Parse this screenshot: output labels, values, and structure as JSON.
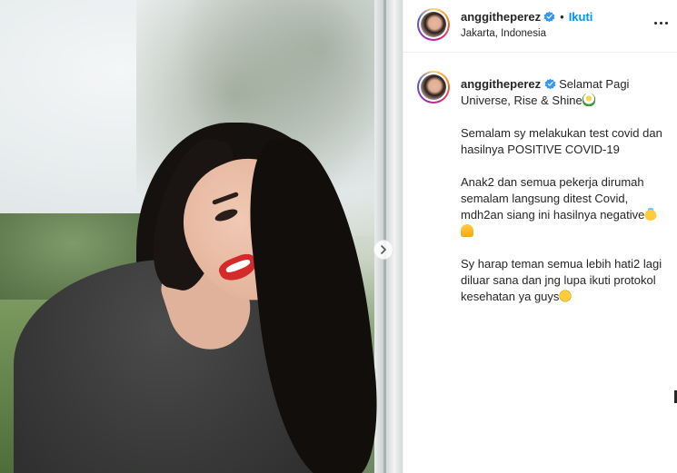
{
  "post": {
    "username": "anggitheperez",
    "follow_label": "Ikuti",
    "separator": "•",
    "location": "Jakarta, Indonesia",
    "caption": {
      "username": "anggitheperez",
      "line1": "Selamat Pagi Universe, Rise & Shine",
      "line1_emoji": "flower-emoji",
      "para2": "Semalam sy melakukan test covid dan hasilnya POSITIVE COVID-19",
      "para3": "Anak2 dan semua pekerja dirumah semalam langsung ditest Covid, mdh2an siang ini hasilnya negative",
      "para3_emojis": [
        "smiling-halo-emoji",
        "folded-hands-emoji"
      ],
      "para4": "Sy harap teman semua lebih hati2 lagi diluar sana dan jng lupa ikuti protokol kesehatan ya guys",
      "para4_emoji": "smile-emoji"
    }
  },
  "icons": {
    "verified": "verified-badge-icon",
    "next": "chevron-right-icon",
    "more": "more-options-icon"
  },
  "colors": {
    "accent": "#0095f6",
    "text": "#262626",
    "border": "#efefef"
  }
}
